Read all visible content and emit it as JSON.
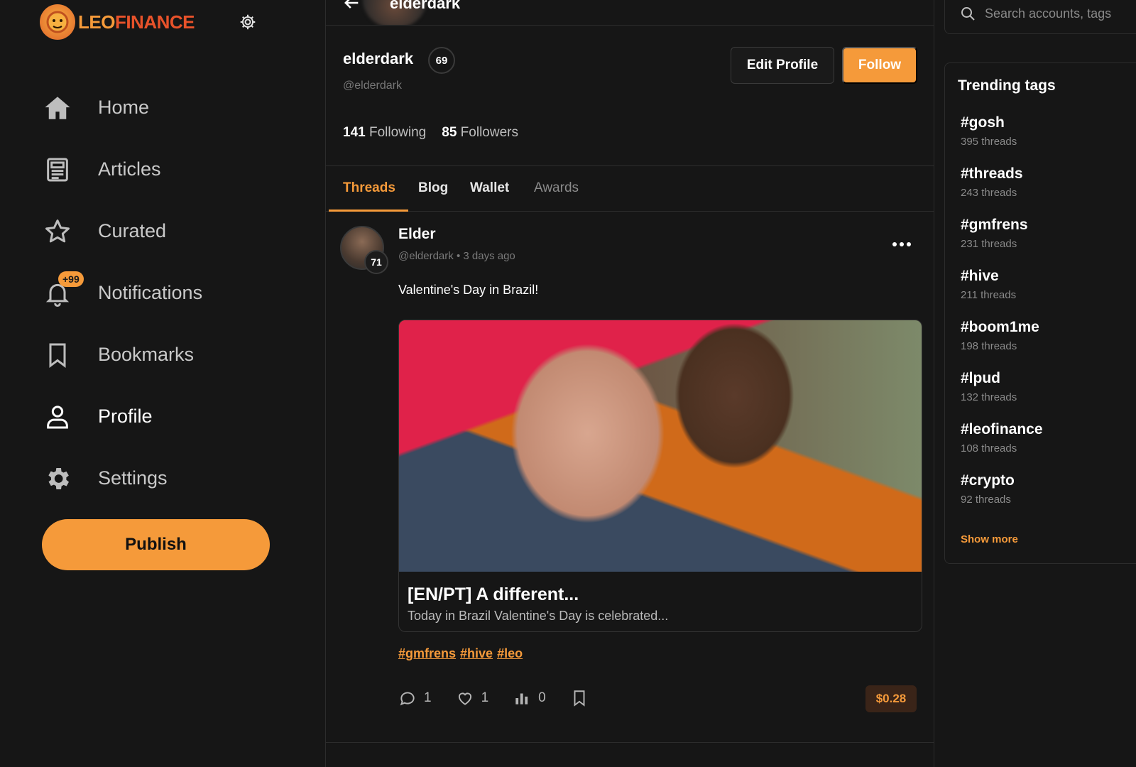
{
  "app": {
    "logo_mark": "",
    "logo_leo": "LEO",
    "logo_finance": "FINANCE"
  },
  "sidebar": {
    "items": [
      {
        "label": "Home",
        "icon": "home-icon"
      },
      {
        "label": "Articles",
        "icon": "newspaper-icon"
      },
      {
        "label": "Curated",
        "icon": "star-icon"
      },
      {
        "label": "Notifications",
        "icon": "bell-icon",
        "badge": "+99"
      },
      {
        "label": "Bookmarks",
        "icon": "bookmark-icon"
      },
      {
        "label": "Profile",
        "icon": "user-icon",
        "active": true
      },
      {
        "label": "Settings",
        "icon": "gear-icon"
      }
    ],
    "publish_label": "Publish"
  },
  "header": {
    "title": "elderdark"
  },
  "profile": {
    "name": "elderdark",
    "reputation": "69",
    "handle": "@elderdark",
    "following_count": "141",
    "following_label": "Following",
    "followers_count": "85",
    "followers_label": "Followers",
    "edit_label": "Edit Profile",
    "follow_label": "Follow"
  },
  "tabs": [
    {
      "label": "Threads",
      "active": true
    },
    {
      "label": "Blog"
    },
    {
      "label": "Wallet"
    },
    {
      "label": "Awards"
    }
  ],
  "post": {
    "author": "Elder",
    "reputation": "71",
    "handle": "@elderdark",
    "separator": "•",
    "time": "3 days ago",
    "text": "Valentine's Day in Brazil!",
    "card_title": "[EN/PT] A different...",
    "card_subtitle": "Today in Brazil Valentine's Day is celebrated...",
    "tags": [
      "#gmfrens",
      "#hive",
      "#leo"
    ],
    "comments": "1",
    "likes": "1",
    "views": "0",
    "reward": "$0.28"
  },
  "search": {
    "placeholder": "Search accounts, tags"
  },
  "trending": {
    "title": "Trending tags",
    "tags": [
      {
        "name": "#gosh",
        "count": "395 threads"
      },
      {
        "name": "#threads",
        "count": "243 threads"
      },
      {
        "name": "#gmfrens",
        "count": "231 threads"
      },
      {
        "name": "#hive",
        "count": "211 threads"
      },
      {
        "name": "#boom1me",
        "count": "198 threads"
      },
      {
        "name": "#lpud",
        "count": "132 threads"
      },
      {
        "name": "#leofinance",
        "count": "108 threads"
      },
      {
        "name": "#crypto",
        "count": "92 threads"
      }
    ],
    "show_more": "Show more"
  },
  "colors": {
    "accent": "#f59a3a",
    "background": "#161616",
    "border": "#2c2c2c"
  }
}
